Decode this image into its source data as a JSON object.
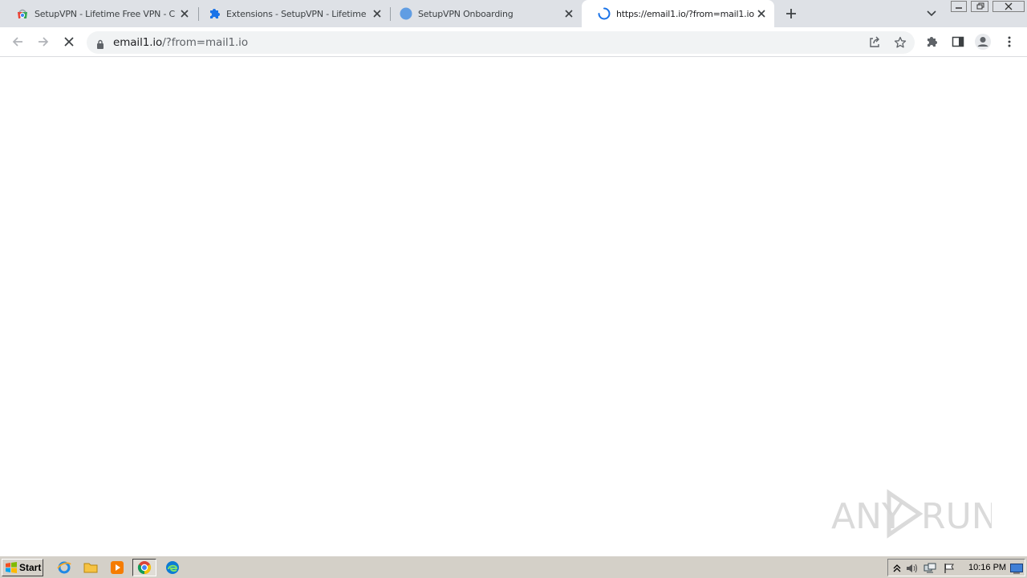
{
  "tabs": [
    {
      "title": "SetupVPN - Lifetime Free VPN - Chro",
      "icon": "chrome-web-store-icon",
      "active": false
    },
    {
      "title": "Extensions - SetupVPN - Lifetime Fre",
      "icon": "puzzle-icon",
      "active": false
    },
    {
      "title": "SetupVPN Onboarding",
      "icon": "globe-icon",
      "active": false
    },
    {
      "title": "https://email1.io/?from=mail1.io",
      "icon": "loading-spinner-icon",
      "active": true
    }
  ],
  "omnibox": {
    "host": "email1.io",
    "path": "/?from=mail1.io"
  },
  "watermark": {
    "text": "ANY RUN"
  },
  "taskbar": {
    "start_label": "Start",
    "clock": "10:16 PM"
  },
  "colors": {
    "tabstrip": "#dee1e6",
    "omnibox": "#f1f3f4",
    "accent": "#1a73e8",
    "taskbar": "#d4d0c8"
  }
}
